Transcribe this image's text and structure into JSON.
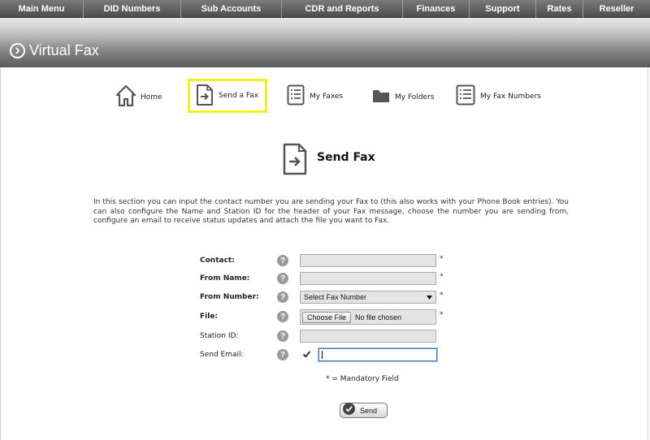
{
  "top_menu": {
    "items": [
      {
        "label": "Main Menu"
      },
      {
        "label": "DID Numbers"
      },
      {
        "label": "Sub Accounts"
      },
      {
        "label": "CDR and Reports"
      },
      {
        "label": "Finances"
      },
      {
        "label": "Support"
      },
      {
        "label": "Rates"
      },
      {
        "label": "Reseller"
      }
    ]
  },
  "page": {
    "title": "Virtual Fax",
    "title_icon": "circle-chevron-right-icon"
  },
  "subnav": {
    "active": "Send a Fax",
    "active_highlight_color": "#f3f01c",
    "items": [
      {
        "label": "Home",
        "icon": "home-icon"
      },
      {
        "label": "Send a Fax",
        "icon": "document-arrow-icon"
      },
      {
        "label": "My Faxes",
        "icon": "list-icon"
      },
      {
        "label": "My Folders",
        "icon": "folder-icon"
      },
      {
        "label": "My Fax Numbers",
        "icon": "list-icon"
      }
    ]
  },
  "section": {
    "heading": "Send Fax",
    "heading_icon": "document-arrow-icon",
    "description": "In this section you can input the contact number you are sending your Fax to (this also works with your Phone Book entries). You can also configure the Name and Station ID for the header of your Fax message, choose the number you are sending from, configure an email to receive status updates and attach the file you want to Fax."
  },
  "form": {
    "contact": {
      "label": "Contact:",
      "value": "",
      "mandatory": "*"
    },
    "from_name": {
      "label": "From Name:",
      "value": "",
      "mandatory": "*"
    },
    "from_number": {
      "label": "From Number:",
      "selected": "Select Fax Number",
      "mandatory": "*"
    },
    "file": {
      "label": "File:",
      "button_label": "Choose File",
      "status": "No file chosen",
      "mandatory": "*"
    },
    "station_id": {
      "label": "Station ID:",
      "value": ""
    },
    "send_email": {
      "label": "Send Email:",
      "checked": true,
      "value": ""
    },
    "help_glyph": "?"
  },
  "mandatory_note": "* = Mandatory Field",
  "send_button": {
    "label": "Send",
    "icon": "check-circle-icon"
  }
}
